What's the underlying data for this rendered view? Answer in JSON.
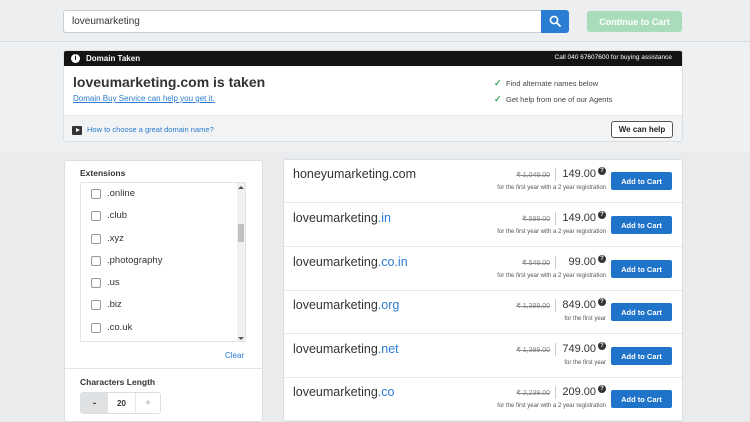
{
  "search": {
    "value": "loveumarketing",
    "continue_label": "Continue to Cart"
  },
  "taken": {
    "header_title": "Domain Taken",
    "header_call": "Call 040 67607600 for buying assistance",
    "title": "loveumarketing.com is taken",
    "buy_service_link": "Domain Buy Service can help you get it.",
    "tips": [
      "Find alternate names below",
      "Get help from one of our Agents"
    ],
    "howto_link": "How to choose a great domain name?",
    "help_button": "We can help"
  },
  "filters": {
    "extensions_title": "Extensions",
    "extensions": [
      ".online",
      ".club",
      ".xyz",
      ".photography",
      ".us",
      ".biz",
      ".co.uk"
    ],
    "clear_label": "Clear",
    "length_title": "Characters Length",
    "length_value": "20",
    "minus_label": "-",
    "plus_label": "+"
  },
  "results": [
    {
      "name": "honeyumarketing",
      "tld": ".com",
      "old_price": "₹ 1,049.00",
      "price": "149.00",
      "note": "for the first year with a 2 year registration",
      "button": "Add to Cart"
    },
    {
      "name": "loveumarketing",
      "tld": ".in",
      "old_price": "₹ 599.00",
      "price": "149.00",
      "note": "for the first year with a 2 year registration",
      "button": "Add to Cart"
    },
    {
      "name": "loveumarketing",
      "tld": ".co.in",
      "old_price": "₹ 549.00",
      "price": "99.00",
      "note": "for the first year with a 2 year registration",
      "button": "Add to Cart"
    },
    {
      "name": "loveumarketing",
      "tld": ".org",
      "old_price": "₹ 1,399.00",
      "price": "849.00",
      "note": "for the first year",
      "button": "Add to Cart"
    },
    {
      "name": "loveumarketing",
      "tld": ".net",
      "old_price": "₹ 1,399.00",
      "price": "749.00",
      "note": "for the first year",
      "button": "Add to Cart"
    },
    {
      "name": "loveumarketing",
      "tld": ".co",
      "old_price": "₹ 2,239.00",
      "price": "209.00",
      "note": "for the first year with a 2 year registration",
      "button": "Add to Cart"
    }
  ],
  "colors": {
    "accent": "#2b7cd3",
    "add_button": "#1f73c9",
    "continue_disabled": "#a9dcb9",
    "check": "#3aa657"
  }
}
